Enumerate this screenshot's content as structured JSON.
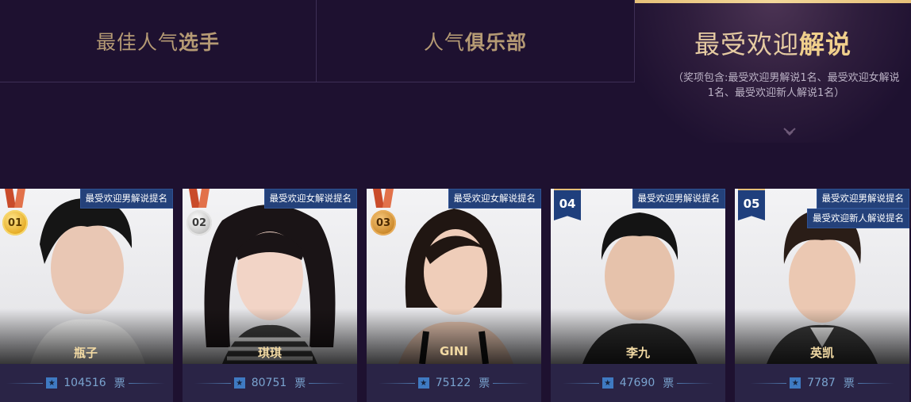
{
  "tabs": [
    {
      "light": "最佳人气",
      "bold": "选手"
    },
    {
      "light": "人气",
      "bold": "俱乐部"
    },
    {
      "light": "最受欢迎",
      "bold": "解说",
      "note_line1": "（奖项包含:最受欢迎男解说1名、最受欢迎女解说",
      "note_line2": "1名、最受欢迎新人解说1名）"
    }
  ],
  "votes_unit": "票",
  "cards": [
    {
      "rank": "01",
      "rank_style": "medal-gold",
      "name": "瓶子",
      "badges": [
        "最受欢迎男解说提名"
      ],
      "votes": "104516"
    },
    {
      "rank": "02",
      "rank_style": "medal-silver",
      "name": "琪琪",
      "badges": [
        "最受欢迎女解说提名"
      ],
      "votes": "80751"
    },
    {
      "rank": "03",
      "rank_style": "medal-bronze",
      "name": "GINI",
      "badges": [
        "最受欢迎女解说提名"
      ],
      "votes": "75122"
    },
    {
      "rank": "04",
      "rank_style": "flag",
      "name": "李九",
      "badges": [
        "最受欢迎男解说提名"
      ],
      "votes": "47690"
    },
    {
      "rank": "05",
      "rank_style": "flag",
      "name": "英凯",
      "badges": [
        "最受欢迎男解说提名",
        "最受欢迎新人解说提名"
      ],
      "votes": "7787"
    }
  ],
  "colors": {
    "background": "#1e1130",
    "gold_text": "#b59a74",
    "active_gold": "#f0cf8c",
    "badge_blue": "#24417a",
    "vote_blue": "#7aa3cf"
  }
}
